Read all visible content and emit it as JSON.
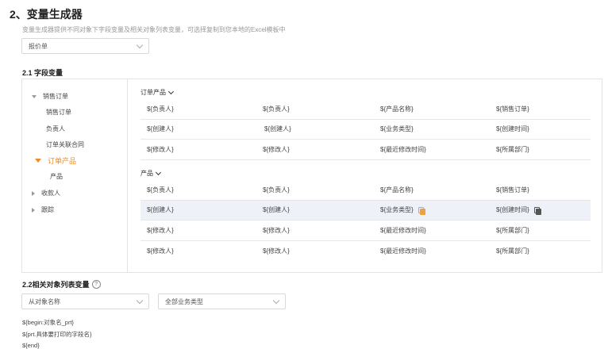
{
  "title": "2、变量生成器",
  "description": "变量生成器提供不同对象下字段变量及相关对象列表变量，可选择复制到您本地的Excel模板中",
  "object_select": {
    "value": "报价单"
  },
  "section1": {
    "title": "2.1 字段变量"
  },
  "tree": {
    "items": [
      {
        "label": "销售订单",
        "state": "expanded"
      },
      {
        "label": "销售订单"
      },
      {
        "label": "负责人"
      },
      {
        "label": "订单关联合同"
      },
      {
        "label": "订单产品",
        "state": "expanded-active"
      },
      {
        "label": "产品"
      },
      {
        "label": "收款人",
        "state": "collapsed"
      },
      {
        "label": "跟踪",
        "state": "collapsed"
      }
    ]
  },
  "groups": [
    {
      "title": "订单产品",
      "rows": [
        [
          "${负责人}",
          "${负责人}",
          "${产品名称}",
          "${销售订单}"
        ],
        [
          "${创建人}",
          "${创建人}",
          "${业务类型}",
          "${创建时间}"
        ],
        [
          "${修改人}",
          "${修改人}",
          "${最近修改时间}",
          "${所属部门}"
        ]
      ]
    },
    {
      "title": "产品",
      "rows": [
        [
          "${负责人}",
          "${负责人}",
          "${产品名称}",
          "${销售订单}"
        ],
        [
          "${创建人}",
          "${创建人}",
          "${业务类型}",
          "${创建时间}"
        ],
        [
          "${修改人}",
          "${修改人}",
          "${最近修改时间}",
          "${所属部门}"
        ],
        [
          "${修改人}",
          "${修改人}",
          "${最近修改时间}",
          "${所属部门}"
        ]
      ]
    }
  ],
  "section2": {
    "title": "2.2相关对象列表变量",
    "help": "?"
  },
  "related_select": {
    "value": "从对象名称"
  },
  "type_select": {
    "value": "全部业务类型"
  },
  "code_lines": [
    "${begin:对象名_prt}",
    "${prt.具体要打印的字段名}",
    "${end}"
  ],
  "icons": {
    "copy": "copy-icon",
    "help": "help-icon",
    "dropdown": "chevron-down-icon"
  },
  "colors": {
    "accent": "#f08a24",
    "highlight_row": "#eef1f8"
  }
}
